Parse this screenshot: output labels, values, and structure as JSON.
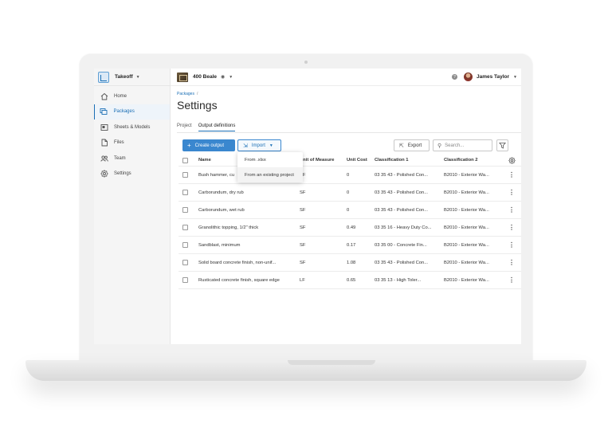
{
  "sidebar": {
    "app_name": "Takeoff",
    "items": [
      {
        "label": "Home",
        "icon": "home-icon"
      },
      {
        "label": "Packages",
        "icon": "packages-icon",
        "active": true
      },
      {
        "label": "Sheets & Models",
        "icon": "sheets-icon"
      },
      {
        "label": "Files",
        "icon": "file-icon"
      },
      {
        "label": "Team",
        "icon": "team-icon"
      },
      {
        "label": "Settings",
        "icon": "gear-icon"
      }
    ]
  },
  "header": {
    "project_name": "400 Beale",
    "user_name": "James Taylor"
  },
  "main": {
    "breadcrumb": "Packages",
    "breadcrumb_sep": "/",
    "title": "Settings",
    "tabs": [
      {
        "label": "Project"
      },
      {
        "label": "Output definitions",
        "active": true
      }
    ],
    "create_button": "Create output",
    "import_button": "Import",
    "export_button": "Export",
    "search_placeholder": "Search...",
    "import_menu": [
      "From .xlsx",
      "From an existing project"
    ],
    "columns": [
      "Name",
      "Unit of Measure",
      "Unit Cost",
      "Classification 1",
      "Classification 2"
    ],
    "rows": [
      {
        "name": "Bush hammer, cu",
        "uom": "SF",
        "cost": "0",
        "cls1": "03 35 43 - Polished Con...",
        "cls2": "B2010 - Exterior Wa..."
      },
      {
        "name": "Carborundum, dry rub",
        "uom": "SF",
        "cost": "0",
        "cls1": "03 35 43 - Polished Con...",
        "cls2": "B2010 - Exterior Wa..."
      },
      {
        "name": "Carborundum, wet rub",
        "uom": "SF",
        "cost": "0",
        "cls1": "03 35 43 - Polished Con...",
        "cls2": "B2010 - Exterior Wa..."
      },
      {
        "name": "Granolithic topping, 1/2\" thick",
        "uom": "SF",
        "cost": "0.49",
        "cls1": "03 35 16 - Heavy Duty Co...",
        "cls2": "B2010 - Exterior Wa..."
      },
      {
        "name": "Sandblast, minimum",
        "uom": "SF",
        "cost": "0.17",
        "cls1": "03 35 00 - Concrete Fin...",
        "cls2": "B2010 - Exterior Wa..."
      },
      {
        "name": "Solid board concrete finish, non-unif...",
        "uom": "SF",
        "cost": "1.08",
        "cls1": "03 35 43 - Polished Con...",
        "cls2": "B2010 - Exterior Wa..."
      },
      {
        "name": "Rusticated concrete finish, square edge",
        "uom": "LF",
        "cost": "0.65",
        "cls1": "03 35 13 - High Toler...",
        "cls2": "B2010 - Exterior Wa..."
      }
    ]
  },
  "colors": {
    "accent": "#3a87cf",
    "link": "#1b6fb5"
  }
}
